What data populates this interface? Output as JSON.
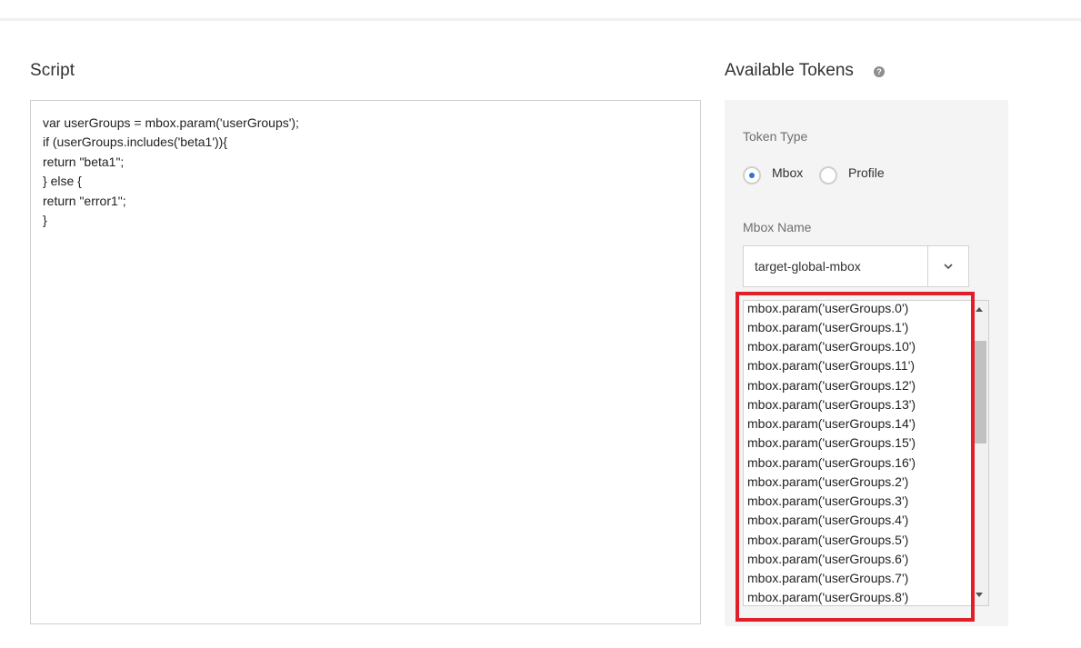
{
  "script": {
    "title": "Script",
    "code_lines": [
      "var userGroups = mbox.param('userGroups');",
      "if (userGroups.includes('beta1')){",
      "return \"beta1\";",
      "} else {",
      "return \"error1\";",
      "}"
    ]
  },
  "tokens": {
    "title": "Available Tokens",
    "help_icon": "question-circle-icon",
    "token_type_label": "Token Type",
    "radio_options": [
      {
        "label": "Mbox",
        "checked": true
      },
      {
        "label": "Profile",
        "checked": false
      }
    ],
    "mbox_name_label": "Mbox Name",
    "mbox_select": {
      "value": "target-global-mbox",
      "icon": "chevron-down-icon"
    },
    "token_list": [
      "mbox.param('userGroups.0')",
      "mbox.param('userGroups.1')",
      "mbox.param('userGroups.10')",
      "mbox.param('userGroups.11')",
      "mbox.param('userGroups.12')",
      "mbox.param('userGroups.13')",
      "mbox.param('userGroups.14')",
      "mbox.param('userGroups.15')",
      "mbox.param('userGroups.16')",
      "mbox.param('userGroups.2')",
      "mbox.param('userGroups.3')",
      "mbox.param('userGroups.4')",
      "mbox.param('userGroups.5')",
      "mbox.param('userGroups.6')",
      "mbox.param('userGroups.7')",
      "mbox.param('userGroups.8')"
    ]
  },
  "colors": {
    "highlight": "#e01f2b",
    "radio_accent": "#2d74d6",
    "panel_bg": "#f4f4f4"
  }
}
